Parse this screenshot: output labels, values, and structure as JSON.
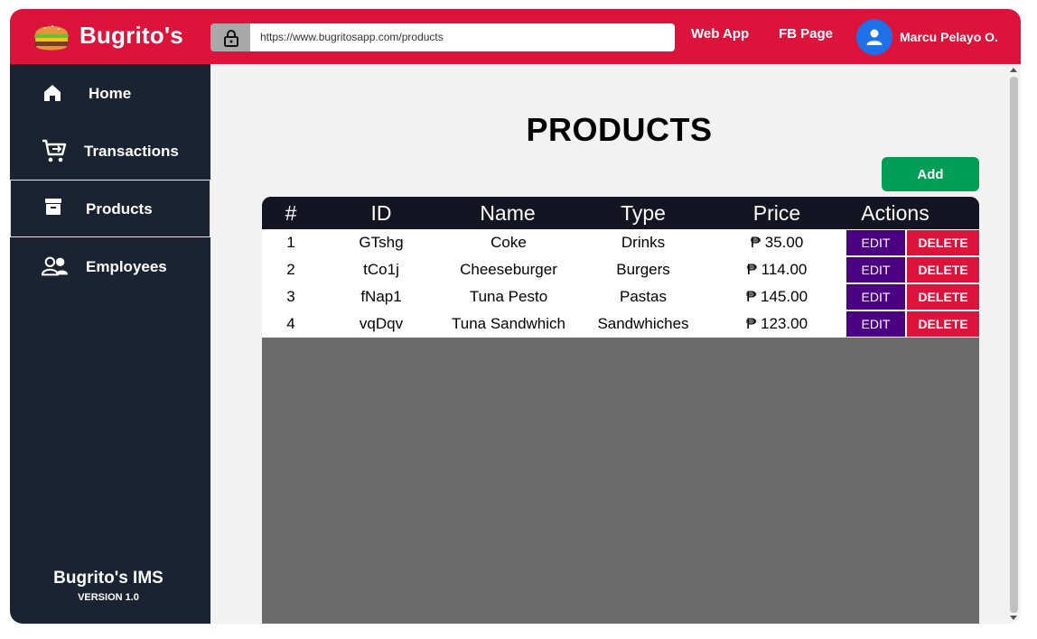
{
  "topbar": {
    "brand": "Bugrito's",
    "url": "https://www.bugritosapp.com/products",
    "links": [
      "Web App",
      "FB Page"
    ],
    "user_name": "Marcu Pelayo O."
  },
  "sidebar": {
    "items": [
      {
        "label": "Home",
        "icon": "home-icon",
        "active": false
      },
      {
        "label": "Transactions",
        "icon": "cart-icon",
        "active": false
      },
      {
        "label": "Products",
        "icon": "archive-box-icon",
        "active": true
      },
      {
        "label": "Employees",
        "icon": "users-icon",
        "active": false
      }
    ],
    "footer_title": "Bugrito's IMS",
    "footer_version": "VERSION 1.0"
  },
  "main": {
    "title": "PRODUCTS",
    "add_label": "Add",
    "table": {
      "headers": [
        "#",
        "ID",
        "Name",
        "Type",
        "Price",
        "Actions"
      ],
      "rows": [
        {
          "num": "1",
          "id": "GTshg",
          "name": "Coke",
          "type": "Drinks",
          "price": "₱ 35.00"
        },
        {
          "num": "2",
          "id": "tCo1j",
          "name": "Cheeseburger",
          "type": "Burgers",
          "price": "₱ 114.00"
        },
        {
          "num": "3",
          "id": "fNap1",
          "name": "Tuna Pesto",
          "type": "Pastas",
          "price": "₱ 145.00"
        },
        {
          "num": "4",
          "id": "vqDqv",
          "name": "Tuna Sandwhich",
          "type": "Sandwhiches",
          "price": "₱ 123.00"
        }
      ],
      "edit_label": "EDIT",
      "delete_label": "DELETE"
    }
  },
  "colors": {
    "brand_red": "#dc143c",
    "sidebar_bg": "#1b2333",
    "add_green": "#009e55",
    "edit_purple": "#4b0082",
    "table_header": "#141423"
  }
}
